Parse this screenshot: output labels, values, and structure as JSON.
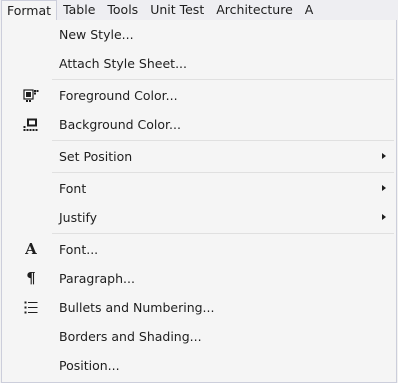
{
  "menubar": {
    "items": [
      "Format",
      "Table",
      "Tools",
      "Unit Test",
      "Architecture",
      "A"
    ]
  },
  "menu": {
    "new_style": "New Style...",
    "attach_style_sheet": "Attach Style Sheet...",
    "foreground_color": "Foreground Color...",
    "background_color": "Background Color...",
    "set_position": "Set Position",
    "font_submenu": "Font",
    "justify": "Justify",
    "font_dialog": "Font...",
    "paragraph": "Paragraph...",
    "bullets_numbering": "Bullets and Numbering...",
    "borders_shading": "Borders and Shading...",
    "position": "Position..."
  },
  "icons": {
    "foreground_color": "foreground-color-icon",
    "background_color": "background-color-icon",
    "font": "font-icon",
    "paragraph": "paragraph-icon",
    "bullets": "bullets-icon"
  },
  "colors": {
    "menu_bg": "#f5f5f5",
    "menubar_bg": "#eeeef2",
    "border": "#cccedb",
    "text": "#1e1e1e"
  }
}
